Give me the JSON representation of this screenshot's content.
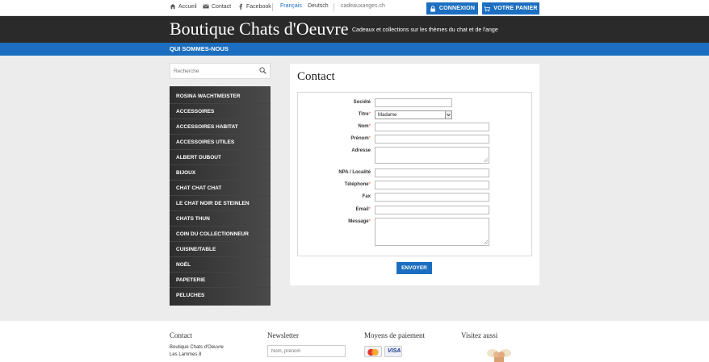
{
  "topbar": {
    "home": "Accueil",
    "contact": "Contact",
    "facebook": "Facebook",
    "lang_fr": "Français",
    "lang_de": "Deutsch",
    "domain": "cadeauxanges.ch",
    "login": "CONNEXION",
    "cart": "VOTRE PANIER"
  },
  "header": {
    "brand": "Boutique Chats d'Oeuvre",
    "tagline": "Cadeaux et collections sur les thèmes du chat et de l'ange"
  },
  "nav": {
    "about": "QUI SOMMES-NOUS"
  },
  "search": {
    "placeholder": "Recherche"
  },
  "categories": [
    "ROSINA WACHTMEISTER",
    "ACCESSOIRES",
    "ACCESSOIRES HABITAT",
    "ACCESSOIRES UTILES",
    "ALBERT DUBOUT",
    "BIJOUX",
    "CHAT CHAT CHAT",
    "LE CHAT NOIR DE STEINLEN",
    "CHATS THUN",
    "COIN DU COLLECTIONNEUR",
    "CUISINE/TABLE",
    "NOËL",
    "PAPETERIE",
    "PELUCHES"
  ],
  "form": {
    "title": "Contact",
    "societe": "Société",
    "titre": "Titre",
    "titre_value": "Madame",
    "nom": "Nom",
    "prenom": "Prénom",
    "adresse": "Adresse",
    "npa": "NPA / Localité",
    "telephone": "Téléphone",
    "fax": "Fax",
    "email": "Email",
    "message": "Message",
    "required_mark": "*",
    "submit": "ENVOYER"
  },
  "footer": {
    "contact_title": "Contact",
    "contact_name": "Boutique Chats d'Oeuvre",
    "contact_street": "Les Lammes 8",
    "newsletter_title": "Newsletter",
    "newsletter_placeholder": "Nom, prénom",
    "payment_title": "Moyens de paiement",
    "visa": "VISA",
    "visit_title": "Visitez aussi"
  },
  "colors": {
    "accent": "#1c6fc0",
    "header_bg": "#2a2a2a",
    "page_bg": "#ececec"
  }
}
